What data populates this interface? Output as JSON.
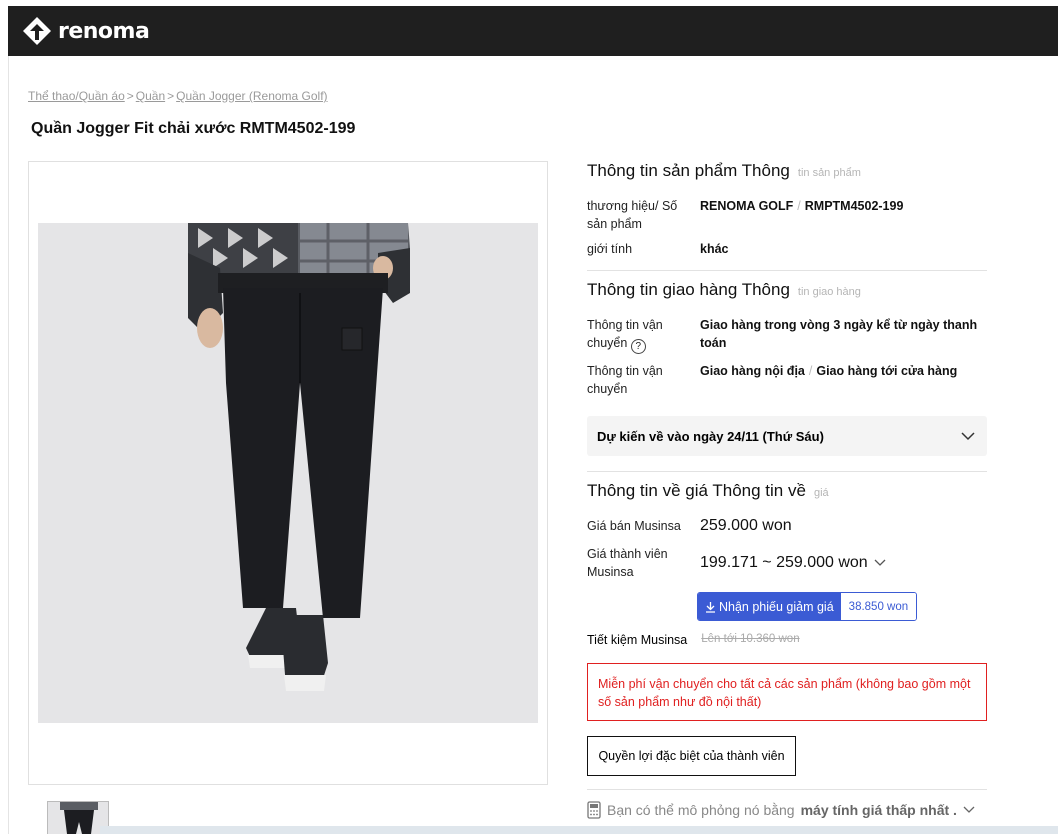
{
  "header": {
    "logo_text": "renoma"
  },
  "breadcrumb": {
    "items": [
      "Thể thao/Quần áo",
      "Quần",
      "Quần Jogger (Renoma Golf)"
    ],
    "separator": ">"
  },
  "product": {
    "title": "Quần Jogger Fit chải xước RMTM4502-199"
  },
  "product_info": {
    "title": "Thông tin sản phẩm Thông",
    "title_ghost": "tin sản phẩm",
    "brand_label": "thương hiệu/ Số sản phẩm",
    "brand": "RENOMA GOLF",
    "sku": "RMPTM4502-199",
    "gender_label": "giới tính",
    "gender": "khác"
  },
  "shipping_info": {
    "title": "Thông tin giao hàng Thông",
    "title_ghost": "tin giao hàng",
    "row1_label": "Thông tin vận chuyển",
    "row1_value": "Giao hàng trong vòng 3 ngày kể từ ngày thanh toán",
    "row2_label": "Thông tin vận chuyển",
    "row2_value_a": "Giao hàng nội địa",
    "row2_value_b": "Giao hàng tới cửa hàng",
    "expected": "Dự kiến về vào ngày 24/11 (Thứ Sáu)"
  },
  "price_info": {
    "title": "Thông tin về giá Thông tin về",
    "title_ghost": "giá",
    "sale_label": "Giá bán Musinsa",
    "sale_price": "259.000 won",
    "member_label": "Giá thành viên Musinsa",
    "member_price": "199.171 ~ 259.000 won",
    "coupon_label": "Nhận phiếu giảm giá",
    "coupon_amount": "38.850 won",
    "savings_label": "Tiết kiệm Musinsa",
    "savings_value": "Lên tới 10.360 won"
  },
  "notice": "Miễn phí vận chuyển cho tất cả các sản phẩm (không bao gồm một số sản phẩm như đồ nội thất)",
  "member_button": "Quyền lợi đặc biệt của thành viên",
  "calculator": {
    "text_prefix": "Bạn có thể mô phỏng nó bằng",
    "text_bold": "máy tính giá thấp nhất ."
  },
  "colors": {
    "header_bg": "#1f1f1f",
    "accent": "#3b5bd4",
    "notice": "#e02020"
  },
  "icons": [
    "renoma-logo-icon",
    "question-icon",
    "chevron-down-icon",
    "download-icon",
    "calculator-icon"
  ]
}
